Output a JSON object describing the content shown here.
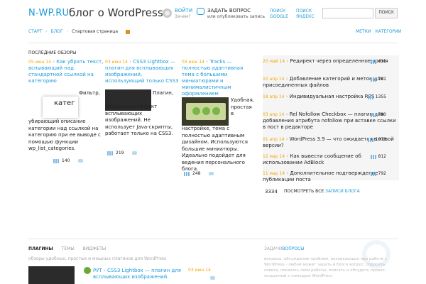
{
  "header": {
    "logo": "N-WP.RU",
    "tagline": "блог о WordPress",
    "login_title": "ВОЙТИ",
    "login_sub": "Зачем?",
    "ask_title": "ЗАДАТЬ ВОПРОС",
    "ask_sub": "или опубликовать запись",
    "google_1": "ПОИСК",
    "google_2": "GOOGLE",
    "yandex_1": "ПОИСК",
    "yandex_2": "ЯНДЕКС",
    "search_placeholder": "",
    "search_button": "ПОИСК"
  },
  "breadcrumbs": {
    "start": "СТАРТ",
    "blog": "БЛОГ",
    "current": "Стартовая страница"
  },
  "nav_right": {
    "tags": "МЕТКИ",
    "categories": "КАТЕГОРИИ"
  },
  "section_title": "ПОСЛЕДНИЕ ОБЗОРЫ",
  "posts": [
    {
      "date": "05 июн 14",
      "title": "Как убрать текст, вспывающий над стандартной ссылкой на категорию",
      "thumb_text": "катег",
      "excerpt_side": "Фильтр,",
      "excerpt": "убирающий описание категории над ссылкой на категорию при ее выводе с помощью функции wp_list_categories.",
      "views": "140"
    },
    {
      "date": "03 июн 14",
      "title": "CSS3 Lightbox — плагин для всплывающих изображений, использующий только CSS3",
      "excerpt_side": "Плагин,",
      "excerpt": "создающий эффект всплывающих изображений. Не использует Java-скрипты, работает только на CSS3.",
      "views": "219"
    },
    {
      "date": "03 июн 14",
      "title": "Tracks — полностью адаптивная тема с большими миниатюрами и минималистичным оформлением",
      "excerpt_side": "Удобная, простая в",
      "excerpt": "настройке, тема с полностью адаптивным дизайном. Используются большие миниатюры. Идеально подойдет для ведения персонального блога.",
      "views": "248"
    }
  ],
  "right_list": [
    {
      "date": "20 май 14",
      "title": "Редирект через определенное время",
      "views": "411"
    },
    {
      "date": "10 апр 14",
      "title": "Добавление категорий и меток для присоединенных файлов",
      "views": "761"
    },
    {
      "date": "18 апр 14",
      "title": "Индивидуальная настройка RSS",
      "views": "1355"
    },
    {
      "date": "03 апр 14",
      "title": "Rel Nofollow Checkbox — плагин для добавления атрибута nofollow при вставке ссылки в пост в редакторе",
      "views": "780"
    },
    {
      "date": "01 апр 14",
      "title": "WordPress 3.9 — что ожидается в новой версии?",
      "views": "1078"
    },
    {
      "date": "12 мар 14",
      "title": "Как вывести сообщение об использовании AdBlock",
      "views": "812"
    },
    {
      "date": "11 мар 14",
      "title": "Дополнительное подтверждение публикации поста",
      "views": "792"
    }
  ],
  "total": "3334",
  "all_posts_prefix": "ПОСМОТРЕТЬ ВСЕ",
  "all_posts_link": "ЗАПИСИ БЛОГА",
  "bottom": {
    "tab_plugins": "ПЛАГИНЫ",
    "tab_themes": "ТЕМЫ",
    "tab_widgets": "ВИДЖЕТЫ",
    "tabs_sub": "обзоры удобных, простых и мощных плагинов для WordPress",
    "q_title_a": "ЗАДАЧИ",
    "q_title_b": "ВОПРОСЫ",
    "q_sub": "вопросы, обсуждение проблем, возникающих при работе с WordPress - любой может задать в блоге вопрос, спросить совета, показать свои работы, описать и обсудить проект, созданный с помощью WordPress",
    "plugin_tag": "РУТ",
    "plugin_title": "CSS3 Lightbox — плагин для всплывающих изображений.",
    "plugin_date": "03 июн 14"
  }
}
